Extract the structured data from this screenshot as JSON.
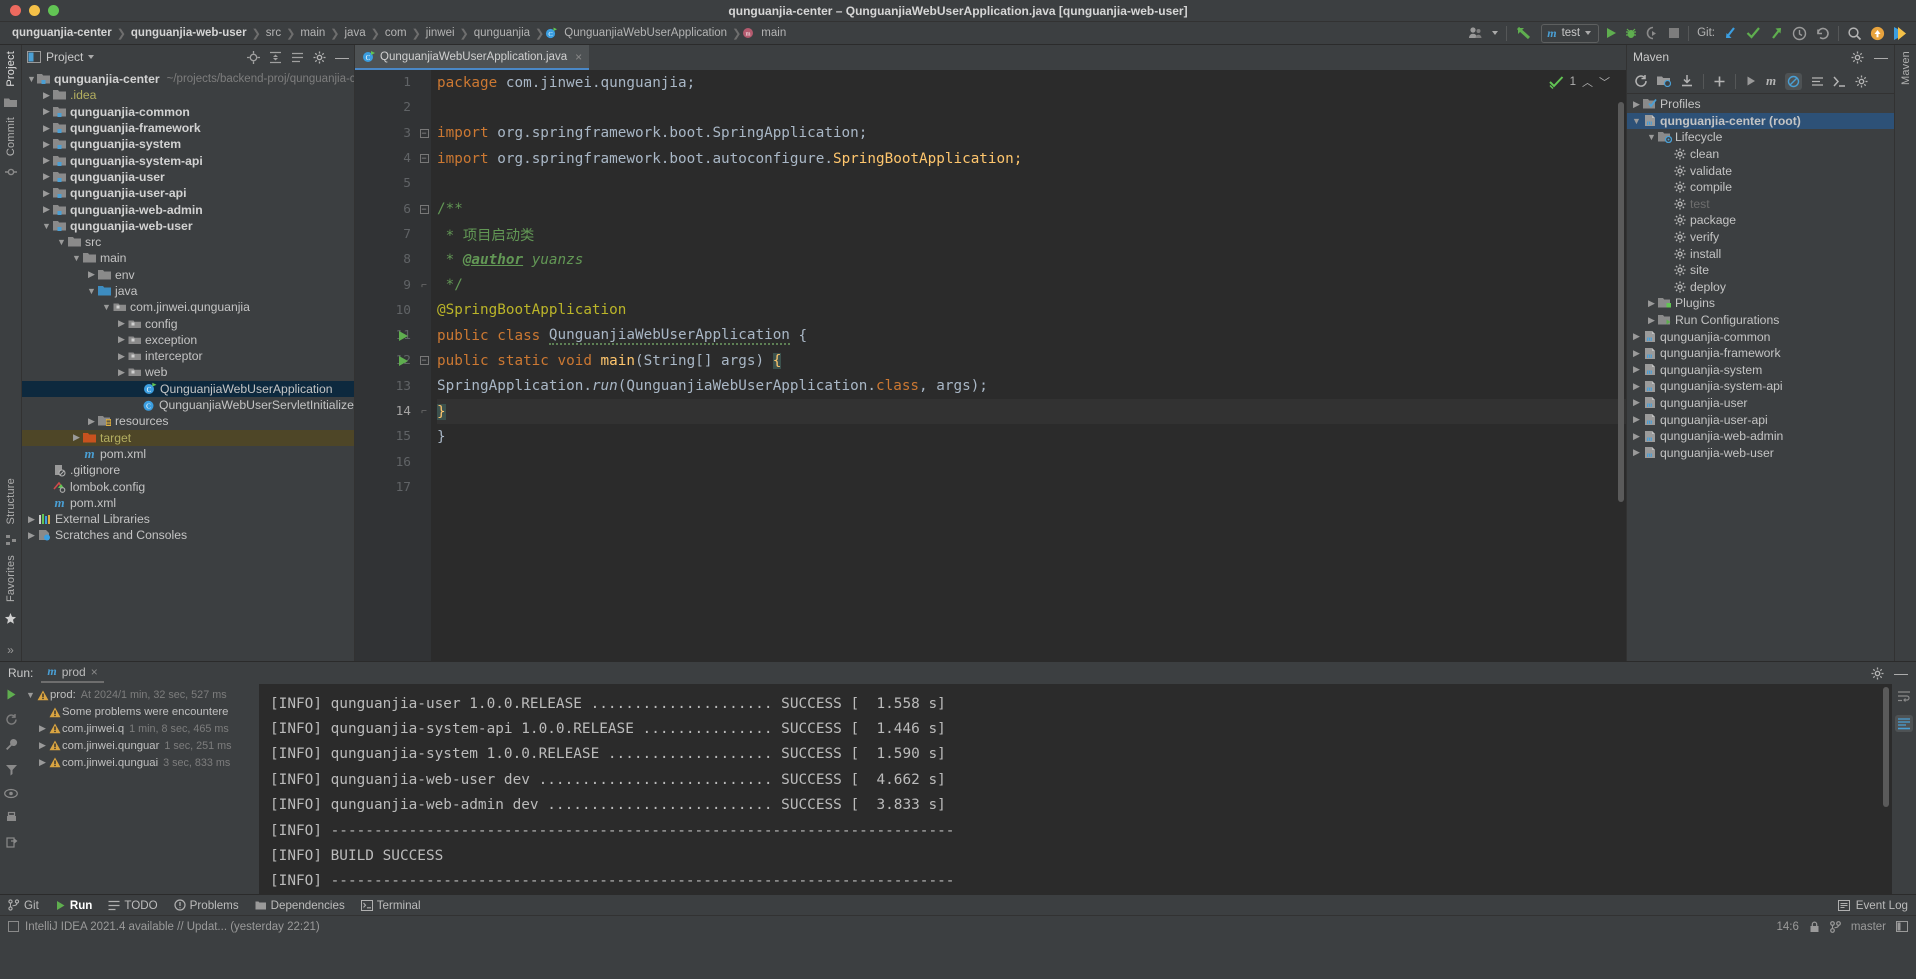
{
  "window": {
    "title": "qunguanjia-center – QunguanjiaWebUserApplication.java [qunguanjia-web-user]"
  },
  "breadcrumb": {
    "items": [
      {
        "label": "qunguanjia-center",
        "bold": true
      },
      {
        "label": "qunguanjia-web-user",
        "bold": true
      },
      {
        "label": "src",
        "bold": false
      },
      {
        "label": "main",
        "bold": false
      },
      {
        "label": "java",
        "bold": false
      },
      {
        "label": "com",
        "bold": false
      },
      {
        "label": "jinwei",
        "bold": false
      },
      {
        "label": "qunguanjia",
        "bold": false
      },
      {
        "label": "QunguanjiaWebUserApplication",
        "bold": false,
        "icon": "class-icon"
      },
      {
        "label": "main",
        "bold": false,
        "icon": "method-icon"
      }
    ]
  },
  "toolbar": {
    "run_config": "test",
    "run_config_icon": "maven-m-icon",
    "git_label": "Git:",
    "avatar_icon": "user-avatar-icon",
    "back_arrow_icon": "back-arrow-icon",
    "run_icon": "run-icon",
    "debug_icon": "debug-icon",
    "coverage_icon": "run-with-coverage-icon",
    "stop_icon": "stop-icon",
    "update_project_icon": "update-project-icon",
    "commit_icon": "commit-checkmark-icon",
    "push_icon": "push-icon",
    "history_icon": "history-icon",
    "rollback_icon": "rollback-icon",
    "search_icon": "search-everywhere-icon",
    "notification_icon": "notification-icon",
    "ide_icon": "ide-logo-icon"
  },
  "left_rail": {
    "items": [
      "Project",
      "Commit",
      "Structure",
      "Favorites"
    ]
  },
  "project_panel": {
    "title": "Project",
    "toolbar_icons": [
      "locate-icon",
      "expand-collapse-icon",
      "collapse-all-icon",
      "settings-gear-icon",
      "hide-icon"
    ],
    "tree": [
      {
        "depth": 0,
        "arrow": "down",
        "icon": "module-icon",
        "label": "qunguanjia-center",
        "bold": true,
        "path": "~/projects/backend-proj/qunguanjia-cen"
      },
      {
        "depth": 1,
        "arrow": "right",
        "icon": "folder-icon",
        "label": ".idea",
        "color": "yellow"
      },
      {
        "depth": 1,
        "arrow": "right",
        "icon": "module-icon",
        "label": "qunguanjia-common",
        "bold": true
      },
      {
        "depth": 1,
        "arrow": "right",
        "icon": "module-icon",
        "label": "qunguanjia-framework",
        "bold": true
      },
      {
        "depth": 1,
        "arrow": "right",
        "icon": "module-icon",
        "label": "qunguanjia-system",
        "bold": true
      },
      {
        "depth": 1,
        "arrow": "right",
        "icon": "module-icon",
        "label": "qunguanjia-system-api",
        "bold": true
      },
      {
        "depth": 1,
        "arrow": "right",
        "icon": "module-icon",
        "label": "qunguanjia-user",
        "bold": true
      },
      {
        "depth": 1,
        "arrow": "right",
        "icon": "module-icon",
        "label": "qunguanjia-user-api",
        "bold": true
      },
      {
        "depth": 1,
        "arrow": "right",
        "icon": "module-icon",
        "label": "qunguanjia-web-admin",
        "bold": true
      },
      {
        "depth": 1,
        "arrow": "down",
        "icon": "module-icon",
        "label": "qunguanjia-web-user",
        "bold": true
      },
      {
        "depth": 2,
        "arrow": "down",
        "icon": "folder-icon",
        "label": "src"
      },
      {
        "depth": 3,
        "arrow": "down",
        "icon": "folder-icon",
        "label": "main"
      },
      {
        "depth": 4,
        "arrow": "right",
        "icon": "folder-icon",
        "label": "env"
      },
      {
        "depth": 4,
        "arrow": "down",
        "icon": "source-folder-icon",
        "label": "java"
      },
      {
        "depth": 5,
        "arrow": "down",
        "icon": "package-icon",
        "label": "com.jinwei.qunguanjia"
      },
      {
        "depth": 6,
        "arrow": "right",
        "icon": "package-icon",
        "label": "config"
      },
      {
        "depth": 6,
        "arrow": "right",
        "icon": "package-icon",
        "label": "exception"
      },
      {
        "depth": 6,
        "arrow": "right",
        "icon": "package-icon",
        "label": "interceptor"
      },
      {
        "depth": 6,
        "arrow": "right",
        "icon": "package-icon",
        "label": "web"
      },
      {
        "depth": 7,
        "arrow": "none",
        "icon": "runnable-class-icon",
        "label": "QunguanjiaWebUserApplication",
        "selected": true
      },
      {
        "depth": 7,
        "arrow": "none",
        "icon": "class-icon",
        "label": "QunguanjiaWebUserServletInitializer"
      },
      {
        "depth": 4,
        "arrow": "right",
        "icon": "resources-folder-icon",
        "label": "resources"
      },
      {
        "depth": 3,
        "arrow": "right",
        "icon": "target-folder-icon",
        "label": "target",
        "color": "yellow",
        "highlight": true
      },
      {
        "depth": 3,
        "arrow": "none",
        "icon": "maven-file-icon",
        "label": "pom.xml"
      },
      {
        "depth": 1,
        "arrow": "none",
        "icon": "gitignore-icon",
        "label": ".gitignore"
      },
      {
        "depth": 1,
        "arrow": "none",
        "icon": "lombok-icon",
        "label": "lombok.config"
      },
      {
        "depth": 1,
        "arrow": "none",
        "icon": "maven-file-icon",
        "label": "pom.xml"
      },
      {
        "depth": 0,
        "arrow": "right",
        "icon": "libraries-icon",
        "label": "External Libraries"
      },
      {
        "depth": 0,
        "arrow": "right",
        "icon": "scratches-icon",
        "label": "Scratches and Consoles"
      }
    ]
  },
  "editor": {
    "tab": {
      "label": "QunguanjiaWebUserApplication.java",
      "icon": "runnable-class-icon",
      "close": "×"
    },
    "inspection_count": "1",
    "lines": [
      {
        "n": 1,
        "fold": "none",
        "runmark": false
      },
      {
        "n": 2,
        "fold": "none",
        "runmark": false
      },
      {
        "n": 3,
        "fold": "minus",
        "runmark": false
      },
      {
        "n": 4,
        "fold": "minus",
        "runmark": false
      },
      {
        "n": 5,
        "fold": "none",
        "runmark": false
      },
      {
        "n": 6,
        "fold": "minus",
        "runmark": false
      },
      {
        "n": 7,
        "fold": "none",
        "runmark": false
      },
      {
        "n": 8,
        "fold": "none",
        "runmark": false
      },
      {
        "n": 9,
        "fold": "end",
        "runmark": false
      },
      {
        "n": 10,
        "fold": "none",
        "runmark": false
      },
      {
        "n": 11,
        "fold": "none",
        "runmark": true
      },
      {
        "n": 12,
        "fold": "minus",
        "runmark": true
      },
      {
        "n": 13,
        "fold": "none",
        "runmark": false
      },
      {
        "n": 14,
        "fold": "end",
        "runmark": false,
        "current": true
      },
      {
        "n": 15,
        "fold": "none",
        "runmark": false
      },
      {
        "n": 16,
        "fold": "none",
        "runmark": false
      },
      {
        "n": 17,
        "fold": "none",
        "runmark": false
      }
    ],
    "code": {
      "l1_kw": "package",
      "l1_rest": " com.jinwei.qunguanjia;",
      "l3_kw": "import",
      "l3_rest": " org.springframework.boot.SpringApplication;",
      "l4_kw": "import",
      "l4_rest": " org.springframework.boot.autoconfigure.",
      "l4_cls": "SpringBootApplication;",
      "l6": "/**",
      "l7": " * 项目启动类",
      "l8_pre": " * ",
      "l8_tag": "@author",
      "l8_post": " yuanzs",
      "l9": " */",
      "l10": "@SpringBootApplication",
      "l11_kw": "public class ",
      "l11_name": "QunguanjiaWebUserApplication",
      "l11_brace": " {",
      "l12_kw": "public static void ",
      "l12_mth": "main",
      "l12_args": "(String[] args) ",
      "l12_brace": "{",
      "l13_pre": "SpringApplication.",
      "l13_run": "run",
      "l13_mid": "(QunguanjiaWebUserApplication.",
      "l13_class": "class",
      "l13_post": ", args);",
      "l14": "}",
      "l15": "}"
    }
  },
  "maven_panel": {
    "title": "Maven",
    "toolbar_icons": [
      "reimport-icon",
      "generate-sources-icon",
      "download-sources-icon",
      "add-maven-project-icon",
      "run-icon",
      "maven-m-icon",
      "toggle-offline-icon",
      "skip-tests-icon",
      "execute-goal-icon",
      "settings-gear-icon"
    ],
    "tree": [
      {
        "depth": 0,
        "arrow": "right",
        "icon": "profiles-icon",
        "label": "Profiles"
      },
      {
        "depth": 0,
        "arrow": "down",
        "icon": "maven-project-icon",
        "label": "qunguanjia-center (root)",
        "bold": true,
        "selected": true
      },
      {
        "depth": 1,
        "arrow": "down",
        "icon": "lifecycle-icon",
        "label": "Lifecycle"
      },
      {
        "depth": 2,
        "arrow": "none",
        "icon": "gear-icon",
        "label": "clean"
      },
      {
        "depth": 2,
        "arrow": "none",
        "icon": "gear-icon",
        "label": "validate"
      },
      {
        "depth": 2,
        "arrow": "none",
        "icon": "gear-icon",
        "label": "compile"
      },
      {
        "depth": 2,
        "arrow": "none",
        "icon": "gear-icon",
        "label": "test",
        "dim": true
      },
      {
        "depth": 2,
        "arrow": "none",
        "icon": "gear-icon",
        "label": "package"
      },
      {
        "depth": 2,
        "arrow": "none",
        "icon": "gear-icon",
        "label": "verify"
      },
      {
        "depth": 2,
        "arrow": "none",
        "icon": "gear-icon",
        "label": "install"
      },
      {
        "depth": 2,
        "arrow": "none",
        "icon": "gear-icon",
        "label": "site"
      },
      {
        "depth": 2,
        "arrow": "none",
        "icon": "gear-icon",
        "label": "deploy"
      },
      {
        "depth": 1,
        "arrow": "right",
        "icon": "plugins-icon",
        "label": "Plugins"
      },
      {
        "depth": 1,
        "arrow": "right",
        "icon": "run-configurations-icon",
        "label": "Run Configurations"
      },
      {
        "depth": 0,
        "arrow": "right",
        "icon": "maven-project-icon",
        "label": "qunguanjia-common"
      },
      {
        "depth": 0,
        "arrow": "right",
        "icon": "maven-project-icon",
        "label": "qunguanjia-framework"
      },
      {
        "depth": 0,
        "arrow": "right",
        "icon": "maven-project-icon",
        "label": "qunguanjia-system"
      },
      {
        "depth": 0,
        "arrow": "right",
        "icon": "maven-project-icon",
        "label": "qunguanjia-system-api"
      },
      {
        "depth": 0,
        "arrow": "right",
        "icon": "maven-project-icon",
        "label": "qunguanjia-user"
      },
      {
        "depth": 0,
        "arrow": "right",
        "icon": "maven-project-icon",
        "label": "qunguanjia-user-api"
      },
      {
        "depth": 0,
        "arrow": "right",
        "icon": "maven-project-icon",
        "label": "qunguanjia-web-admin"
      },
      {
        "depth": 0,
        "arrow": "right",
        "icon": "maven-project-icon",
        "label": "qunguanjia-web-user"
      }
    ]
  },
  "right_rail": {
    "items": [
      "Maven"
    ]
  },
  "run_panel": {
    "label": "Run:",
    "tab": "prod",
    "tab_icon": "maven-m-icon",
    "tab_close": "×",
    "tree": [
      {
        "depth": 0,
        "arrow": "down",
        "icon": "warning-icon",
        "label": "prod:",
        "extra": "At 2024/1 min, 32 sec, 527 ms"
      },
      {
        "depth": 1,
        "arrow": "none",
        "icon": "warning-icon",
        "label": "Some problems were encountere"
      },
      {
        "depth": 1,
        "arrow": "right",
        "icon": "warning-icon",
        "label": "com.jinwei.q",
        "extra": "1 min, 8 sec, 465 ms"
      },
      {
        "depth": 1,
        "arrow": "right",
        "icon": "warning-icon",
        "label": "com.jinwei.qunguar",
        "extra": "1 sec, 251 ms"
      },
      {
        "depth": 1,
        "arrow": "right",
        "icon": "warning-icon",
        "label": "com.jinwei.qunguai",
        "extra": "3 sec, 833 ms"
      }
    ],
    "console": [
      "[INFO] qunguanjia-user 1.0.0.RELEASE ..................... SUCCESS [  1.558 s]",
      "[INFO] qunguanjia-system-api 1.0.0.RELEASE ............... SUCCESS [  1.446 s]",
      "[INFO] qunguanjia-system 1.0.0.RELEASE ................... SUCCESS [  1.590 s]",
      "[INFO] qunguanjia-web-user dev ........................... SUCCESS [  4.662 s]",
      "[INFO] qunguanjia-web-admin dev .......................... SUCCESS [  3.833 s]",
      "[INFO] ------------------------------------------------------------------------",
      "[INFO] BUILD SUCCESS",
      "[INFO] ------------------------------------------------------------------------"
    ],
    "rail_icons": [
      "run-icon",
      "rerun-icon",
      "settings-wrench-icon",
      "filter-icon",
      "eye-icon",
      "print-icon",
      "export-icon"
    ],
    "console_rail_icons": [
      "soft-wrap-icon",
      "scroll-to-end-icon"
    ]
  },
  "bottom_bar": {
    "items": [
      {
        "label": "Git",
        "icon": "git-icon",
        "selected": false
      },
      {
        "label": "Run",
        "icon": "run-icon",
        "selected": true
      },
      {
        "label": "TODO",
        "icon": "todo-icon",
        "selected": false
      },
      {
        "label": "Problems",
        "icon": "problems-icon",
        "selected": false
      },
      {
        "label": "Dependencies",
        "icon": "dependencies-icon",
        "selected": false
      },
      {
        "label": "Terminal",
        "icon": "terminal-icon",
        "selected": false
      }
    ],
    "event_log": "Event Log",
    "event_log_icon": "event-log-icon"
  },
  "status_bar": {
    "message": "IntelliJ IDEA 2021.4 available // Updat... (yesterday 22:21)",
    "position": "14:6",
    "branch": "master",
    "branch_icon": "branch-icon",
    "lock_icon": "lock-icon",
    "layout_icon": "layout-icon"
  }
}
